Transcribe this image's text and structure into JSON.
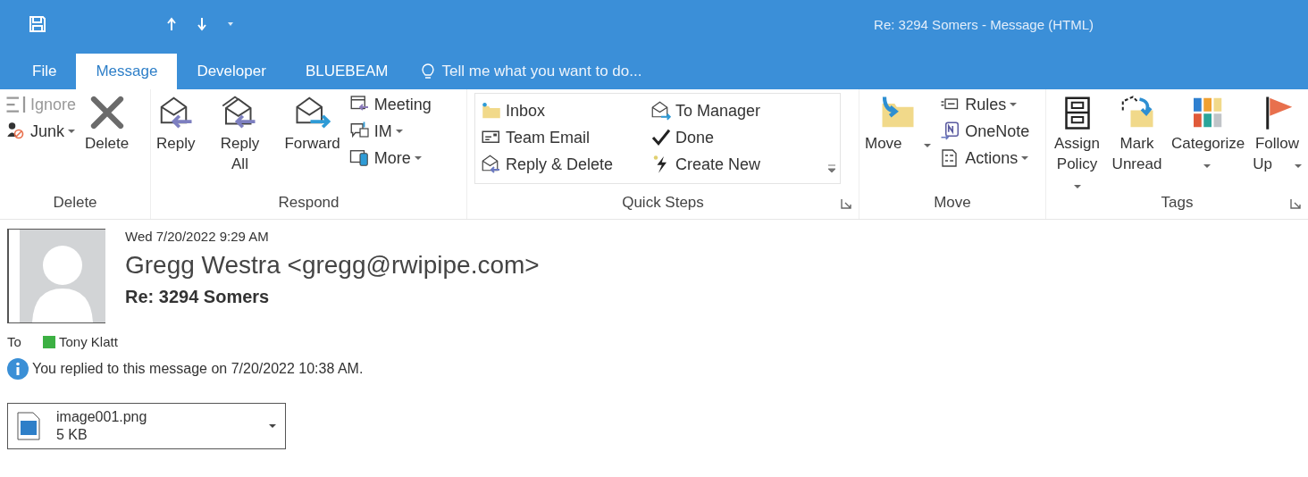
{
  "title_bar": {
    "title": "Re: 3294 Somers - Message (HTML)"
  },
  "tabs": [
    {
      "label": "File",
      "selected": false
    },
    {
      "label": "Message",
      "selected": true
    },
    {
      "label": "Developer",
      "selected": false
    },
    {
      "label": "BLUEBEAM",
      "selected": false
    }
  ],
  "tell_me": {
    "placeholder": "Tell me what you want to do..."
  },
  "ribbon": {
    "groups": [
      {
        "label": "Delete",
        "launcher": false,
        "columns": [
          {
            "kind": "stack",
            "items": [
              {
                "label": "Ignore",
                "dropdown": false,
                "disabled": true
              },
              {
                "label": "Junk",
                "dropdown": true,
                "disabled": false
              }
            ]
          },
          {
            "kind": "large",
            "items": [
              {
                "label": "Delete",
                "dropdown": false,
                "disabled": false
              }
            ]
          }
        ]
      },
      {
        "label": "Respond",
        "launcher": false,
        "columns": [
          {
            "kind": "large",
            "items": [
              {
                "label": "Reply",
                "dropdown": false,
                "disabled": false
              }
            ]
          },
          {
            "kind": "large",
            "items": [
              {
                "label": "Reply All",
                "dropdown": false,
                "disabled": false
              }
            ]
          },
          {
            "kind": "large",
            "items": [
              {
                "label": "Forward",
                "dropdown": false,
                "disabled": false
              }
            ]
          },
          {
            "kind": "stack",
            "items": [
              {
                "label": "Meeting",
                "dropdown": false,
                "disabled": false
              },
              {
                "label": "IM",
                "dropdown": true,
                "disabled": false
              },
              {
                "label": "More",
                "dropdown": true,
                "disabled": false
              }
            ]
          }
        ]
      },
      {
        "label": "Quick Steps",
        "launcher": true,
        "columns": [
          {
            "kind": "gallery",
            "items": [
              {
                "label": "Inbox",
                "dropdown": false,
                "disabled": false
              },
              {
                "label": "Team Email",
                "dropdown": false,
                "disabled": false
              },
              {
                "label": "Reply & Delete",
                "dropdown": false,
                "disabled": false
              },
              {
                "label": "To Manager",
                "dropdown": false,
                "disabled": false
              },
              {
                "label": "Done",
                "dropdown": false,
                "disabled": false
              },
              {
                "label": "Create New",
                "dropdown": false,
                "disabled": false
              }
            ]
          }
        ]
      },
      {
        "label": "Move",
        "launcher": false,
        "columns": [
          {
            "kind": "large",
            "items": [
              {
                "label": "Move",
                "dropdown": true,
                "disabled": false
              }
            ]
          },
          {
            "kind": "stack",
            "items": [
              {
                "label": "Rules",
                "dropdown": true,
                "disabled": false
              },
              {
                "label": "OneNote",
                "dropdown": false,
                "disabled": false
              },
              {
                "label": "Actions",
                "dropdown": true,
                "disabled": false
              }
            ]
          }
        ]
      },
      {
        "label": "Tags",
        "launcher": true,
        "columns": [
          {
            "kind": "large",
            "items": [
              {
                "label": "Assign Policy",
                "dropdown": true,
                "disabled": false
              }
            ]
          },
          {
            "kind": "large",
            "items": [
              {
                "label": "Mark Unread",
                "dropdown": false,
                "disabled": false
              }
            ]
          },
          {
            "kind": "large",
            "items": [
              {
                "label": "Categorize",
                "dropdown": true,
                "disabled": false
              }
            ]
          },
          {
            "kind": "large",
            "items": [
              {
                "label": "Follow Up",
                "dropdown": true,
                "disabled": false
              }
            ]
          }
        ]
      }
    ]
  },
  "message": {
    "date": "Wed 7/20/2022 9:29 AM",
    "from": "Gregg Westra <gregg@rwipipe.com>",
    "subject": "Re: 3294 Somers",
    "to_label": "To",
    "recipients": [
      {
        "name": "Tony Klatt",
        "color": "#3cb043"
      }
    ],
    "info": "You replied to this message on 7/20/2022 10:38 AM.",
    "attachments": [
      {
        "name": "image001.png",
        "size": "5 KB"
      }
    ]
  }
}
